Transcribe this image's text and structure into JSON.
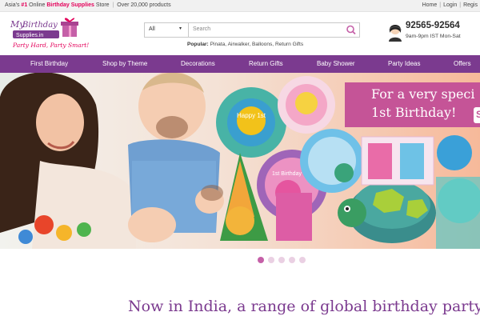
{
  "topbar": {
    "prefix": "Asia's",
    "rank": "#1",
    "middle": "Online",
    "highlight": "Birthday Supplies",
    "store": "Store",
    "products": "Over 20,000 products",
    "links": [
      "Home",
      "Login",
      "Regis"
    ]
  },
  "logo": {
    "text": "My Birthday Supplies.in",
    "tagline": "Party Hard, Party Smart!"
  },
  "search": {
    "category": "All",
    "placeholder": "Search",
    "popular_label": "Popular:",
    "popular_items": "Pinata, Airwalker, Balloons, Return Gifts"
  },
  "support": {
    "phone": "92565-92564",
    "hours": "9am-9pm IST Mon-Sat"
  },
  "nav": {
    "items": [
      "First Birthday",
      "Shop by Theme",
      "Decorations",
      "Return Gifts",
      "Baby Shower",
      "Party Ideas",
      "Offers"
    ]
  },
  "banner": {
    "promo_line1": "For a very speci",
    "promo_line2": "1st Birthday!",
    "promo_cta": "S",
    "plate_text_1": "Happy 1st",
    "plate_text_2": "1st Birthday"
  },
  "slider": {
    "dots": 5,
    "active_index": 0
  },
  "headline": {
    "text": "Now in India, a range of global birthday party"
  },
  "colors": {
    "brand_purple": "#7b3a8f",
    "brand_pink": "#e4005a",
    "promo_pink": "#c55497"
  }
}
